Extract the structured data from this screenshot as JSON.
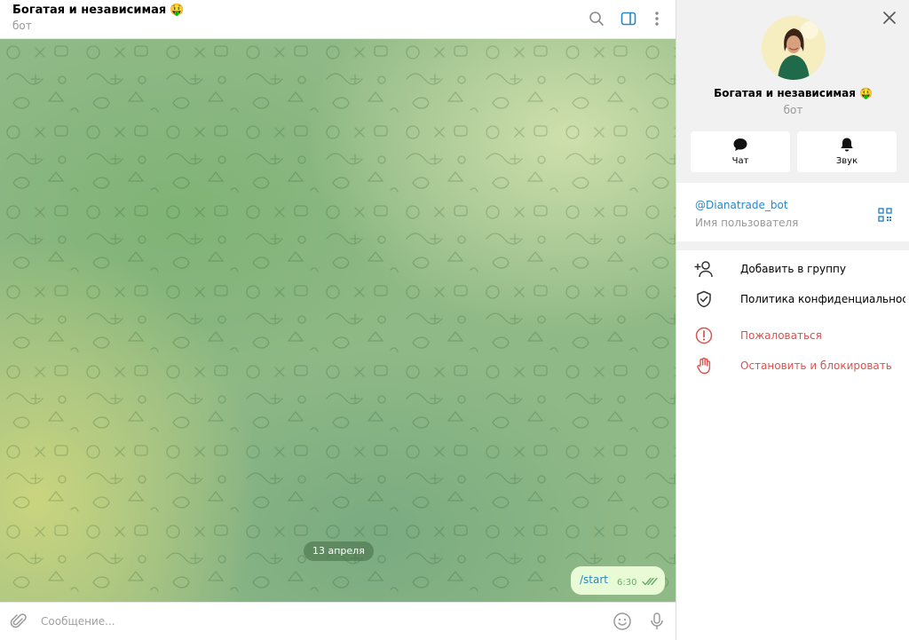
{
  "header": {
    "title": "Богатая и независимая",
    "title_emoji": "🤑",
    "subtitle": "бот",
    "icons": [
      "search-icon",
      "sidebar-toggle-icon",
      "more-vertical-icon"
    ]
  },
  "chat": {
    "date_separator": "13 апреля",
    "messages": [
      {
        "text": "/start",
        "time": "6:30",
        "outgoing": true,
        "status": "read"
      }
    ]
  },
  "composer": {
    "placeholder": "Сообщение...",
    "value": "",
    "icons": [
      "attach-icon",
      "emoji-icon",
      "microphone-icon"
    ]
  },
  "profile": {
    "name": "Богатая и независимая",
    "name_emoji": "🤑",
    "subtitle": "бот",
    "actions": [
      {
        "label": "Чат",
        "icon": "chat-bubble-icon"
      },
      {
        "label": "Звук",
        "icon": "bell-icon"
      }
    ],
    "username": "@Dianatrade_bot",
    "username_caption": "Имя пользователя",
    "menu": [
      {
        "label": "Добавить в группу",
        "icon": "add-user-icon",
        "danger": false
      },
      {
        "label": "Политика конфиденциальност...",
        "icon": "shield-check-icon",
        "danger": false
      },
      {
        "label": "Пожаловаться",
        "icon": "alert-circle-icon",
        "danger": true
      },
      {
        "label": "Остановить и блокировать",
        "icon": "hand-stop-icon",
        "danger": true
      }
    ]
  },
  "colors": {
    "accent": "#2a87c7",
    "danger": "#d9534f",
    "bubble_out": "#e8fbd6",
    "read_check": "#6bab6b",
    "panel_bg": "#f1f1f1"
  }
}
